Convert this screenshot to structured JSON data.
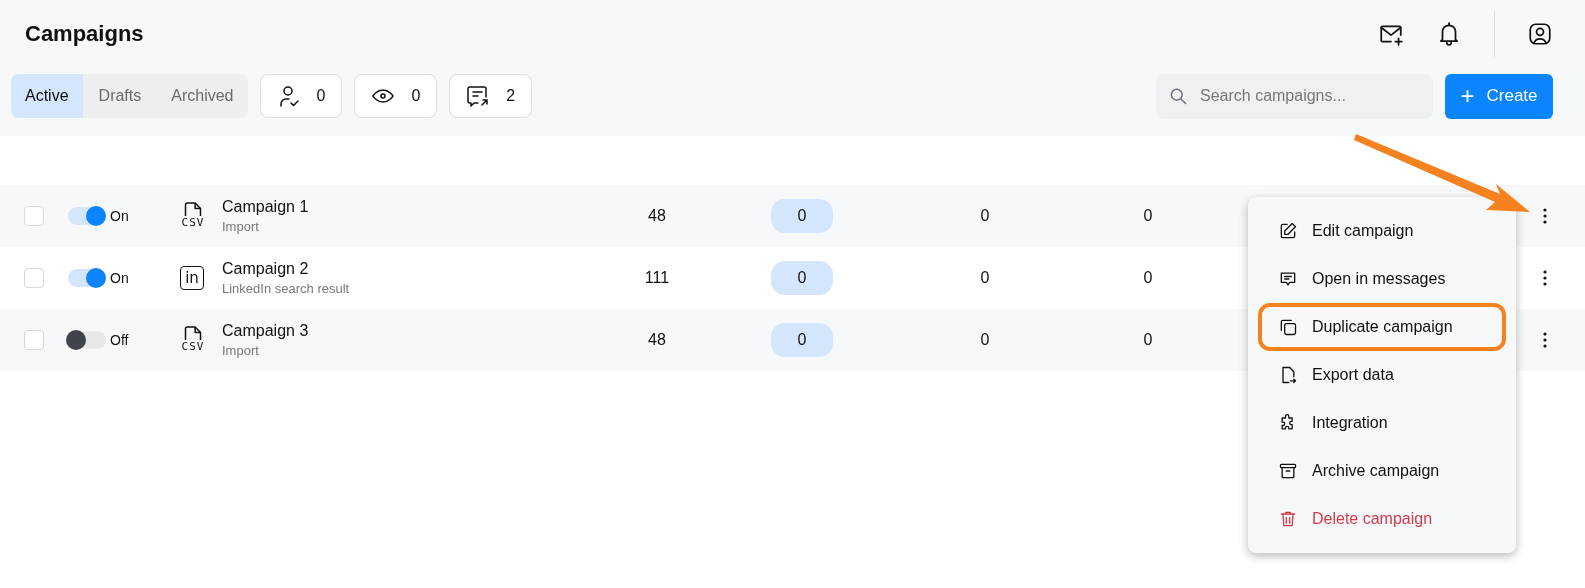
{
  "header": {
    "title": "Campaigns"
  },
  "tabs": [
    {
      "label": "Active",
      "selected": true
    },
    {
      "label": "Drafts",
      "selected": false
    },
    {
      "label": "Archived",
      "selected": false
    }
  ],
  "stats": [
    {
      "kind": "person",
      "value": "0"
    },
    {
      "kind": "eye",
      "value": "0"
    },
    {
      "kind": "message",
      "value": "2"
    }
  ],
  "search": {
    "placeholder": "Search campaigns..."
  },
  "create_button": {
    "icon": "+",
    "label": "Create"
  },
  "rows": [
    {
      "checked": false,
      "on": true,
      "toggle_label": "On",
      "kind": "csv",
      "icon_label": "CSV",
      "name": "Campaign 1",
      "subtitle": "Import",
      "count": "48",
      "badge": "0",
      "column_5": "0",
      "column_6": "0"
    },
    {
      "checked": false,
      "on": true,
      "toggle_label": "On",
      "kind": "linkedin",
      "icon_label": "in",
      "name": "Campaign 2",
      "subtitle": "LinkedIn search result",
      "count": "111",
      "badge": "0",
      "column_5": "0",
      "column_6": "0"
    },
    {
      "checked": false,
      "on": false,
      "toggle_label": "Off",
      "kind": "csv",
      "icon_label": "CSV",
      "name": "Campaign 3",
      "subtitle": "Import",
      "count": "48",
      "badge": "0",
      "column_5": "0",
      "column_6": "0"
    }
  ],
  "context_menu": [
    {
      "kind": "edit",
      "label": "Edit campaign",
      "danger": false,
      "highlighted": false
    },
    {
      "kind": "messages",
      "label": "Open in messages",
      "danger": false,
      "highlighted": false
    },
    {
      "kind": "duplicate",
      "label": "Duplicate campaign",
      "danger": false,
      "highlighted": true
    },
    {
      "kind": "export",
      "label": "Export data",
      "danger": false,
      "highlighted": false
    },
    {
      "kind": "integration",
      "label": "Integration",
      "danger": false,
      "highlighted": false
    },
    {
      "kind": "archive",
      "label": "Archive campaign",
      "danger": false,
      "highlighted": false
    },
    {
      "kind": "delete",
      "label": "Delete campaign",
      "danger": true,
      "highlighted": false
    }
  ]
}
